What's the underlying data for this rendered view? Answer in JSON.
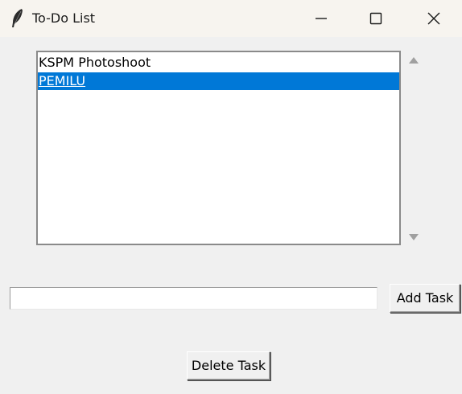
{
  "window": {
    "title": "To-Do List",
    "icon": "feather-icon",
    "controls": [
      "minimize-icon",
      "maximize-icon",
      "close-icon"
    ]
  },
  "tasks": {
    "items": [
      {
        "label": "KSPM Photoshoot",
        "selected": false
      },
      {
        "label": "PEMILU",
        "selected": true
      }
    ],
    "selection_color": "#0078d7"
  },
  "entry": {
    "value": "",
    "placeholder": ""
  },
  "buttons": {
    "add_label": "Add Task",
    "delete_label": "Delete Task"
  }
}
